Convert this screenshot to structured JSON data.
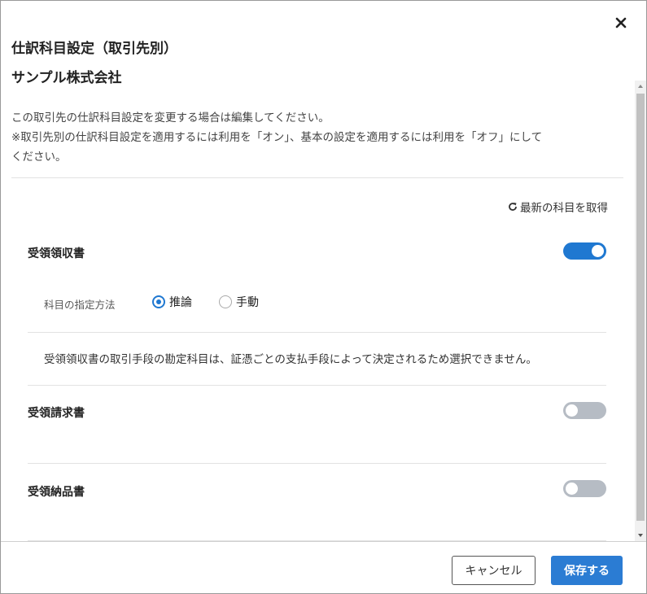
{
  "dialog": {
    "title": "仕訳科目設定（取引先別）",
    "subtitle": "サンプル株式会社",
    "close_icon": "close-icon"
  },
  "description": {
    "line1": "この取引先の仕訳科目設定を変更する場合は編集してください。",
    "line2": "※取引先別の仕訳科目設定を適用するには利用を「オン」、基本の設定を適用するには利用を「オフ」にして",
    "line3": "ください。"
  },
  "refresh": {
    "label": "最新の科目を取得",
    "icon": "refresh-icon"
  },
  "sections": [
    {
      "label": "受領領収書",
      "enabled": true,
      "method_label": "科目の指定方法",
      "options": [
        {
          "label": "推論",
          "selected": true
        },
        {
          "label": "手動",
          "selected": false
        }
      ],
      "note": "受領領収書の取引手段の勘定科目は、証憑ごとの支払手段によって決定されるため選択できません。"
    },
    {
      "label": "受領請求書",
      "enabled": false
    },
    {
      "label": "受領納品書",
      "enabled": false
    }
  ],
  "footer": {
    "cancel_label": "キャンセル",
    "save_label": "保存する"
  },
  "colors": {
    "accent": "#1f78d1",
    "toggle_off": "#b6bcc4",
    "save_button": "#2b7cd3"
  }
}
